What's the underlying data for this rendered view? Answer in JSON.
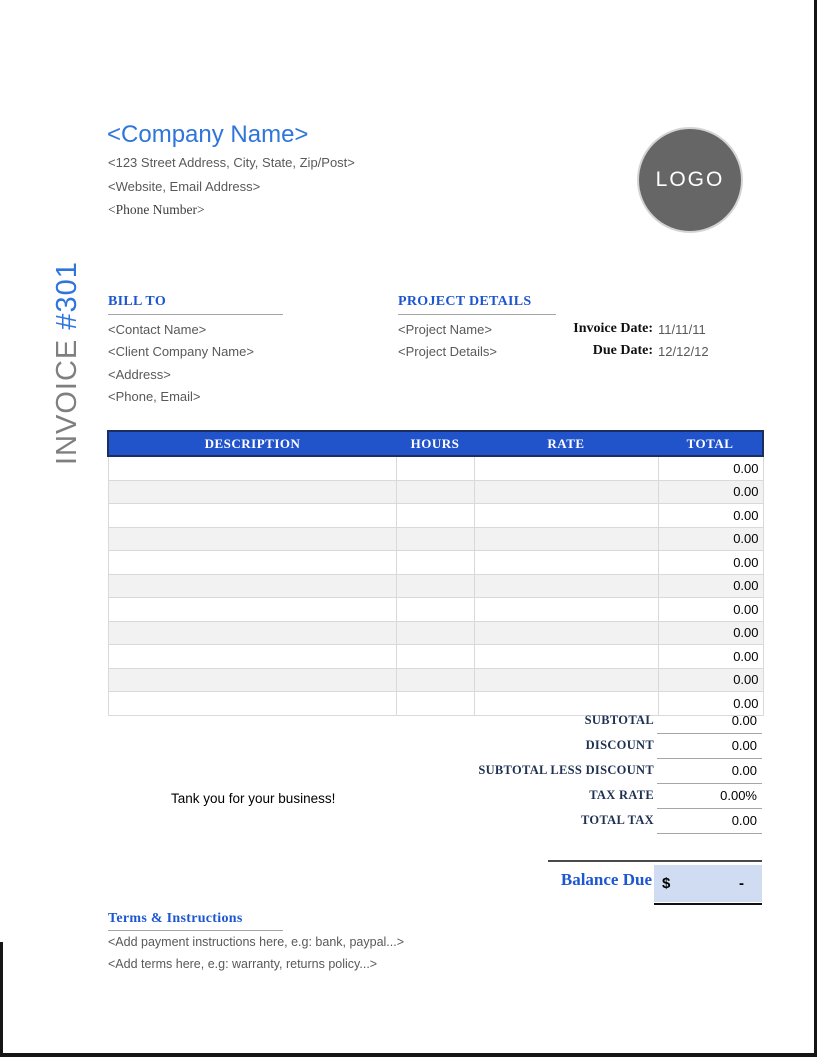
{
  "header": {
    "company_name": "<Company Name>",
    "address": "<123 Street Address, City, State, Zip/Post>",
    "website": "<Website, Email Address>",
    "phone": "<Phone Number>",
    "logo_text": "LOGO"
  },
  "invoice_title": {
    "word": "INVOICE ",
    "number": "#301"
  },
  "bill_to": {
    "title": "BILL TO",
    "lines": [
      "<Contact Name>",
      "<Client Company Name>",
      "<Address>",
      "<Phone, Email>"
    ]
  },
  "project_details": {
    "title": "PROJECT DETAILS",
    "lines": [
      "<Project Name>",
      "<Project Details>"
    ]
  },
  "dates": {
    "invoice_date_label": "Invoice Date:",
    "invoice_date_value": "11/11/11",
    "due_date_label": "Due Date:",
    "due_date_value": "12/12/12"
  },
  "table": {
    "columns": [
      "DESCRIPTION",
      "HOURS",
      "RATE",
      "TOTAL"
    ],
    "rows": [
      {
        "description": "",
        "hours": "",
        "rate": "",
        "total": "0.00"
      },
      {
        "description": "",
        "hours": "",
        "rate": "",
        "total": "0.00"
      },
      {
        "description": "",
        "hours": "",
        "rate": "",
        "total": "0.00"
      },
      {
        "description": "",
        "hours": "",
        "rate": "",
        "total": "0.00"
      },
      {
        "description": "",
        "hours": "",
        "rate": "",
        "total": "0.00"
      },
      {
        "description": "",
        "hours": "",
        "rate": "",
        "total": "0.00"
      },
      {
        "description": "",
        "hours": "",
        "rate": "",
        "total": "0.00"
      },
      {
        "description": "",
        "hours": "",
        "rate": "",
        "total": "0.00"
      },
      {
        "description": "",
        "hours": "",
        "rate": "",
        "total": "0.00"
      },
      {
        "description": "",
        "hours": "",
        "rate": "",
        "total": "0.00"
      },
      {
        "description": "",
        "hours": "",
        "rate": "",
        "total": "0.00"
      }
    ]
  },
  "summary": [
    {
      "label": "SUBTOTAL",
      "value": "0.00"
    },
    {
      "label": "DISCOUNT",
      "value": "0.00"
    },
    {
      "label": "SUBTOTAL LESS DISCOUNT",
      "value": "0.00"
    },
    {
      "label": "TAX RATE",
      "value": "0.00%"
    },
    {
      "label": "TOTAL TAX",
      "value": "0.00"
    }
  ],
  "note": "Tank you for your business!",
  "balance": {
    "label": "Balance Due",
    "currency": "$",
    "value": "-"
  },
  "terms": {
    "title": "Terms & Instructions",
    "lines": [
      "<Add payment instructions here, e.g: bank, paypal...>",
      "<Add terms here, e.g: warranty, returns policy...>"
    ]
  },
  "colors": {
    "heading_blue": "#1d56d2",
    "company_blue": "#2e75dc",
    "table_header_blue": "#2154cb",
    "balance_box_blue": "#cfdcf1"
  }
}
